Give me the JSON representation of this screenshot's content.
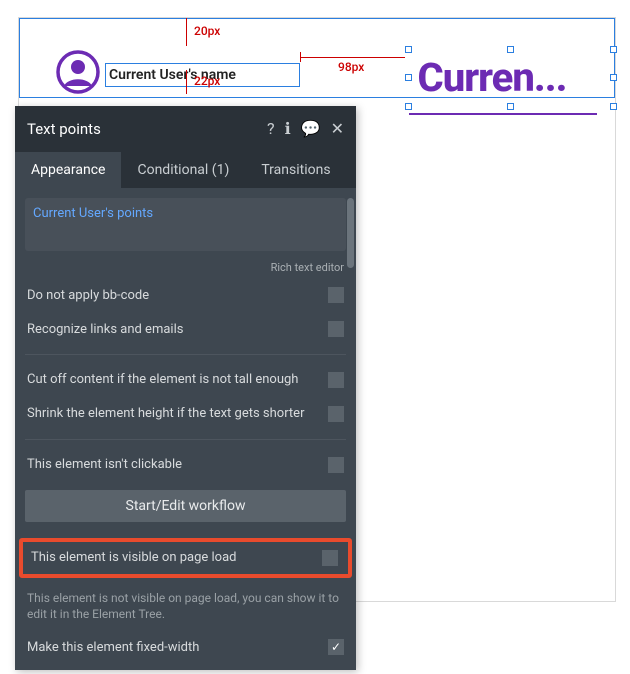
{
  "canvas": {
    "name_expression": "Current User's name",
    "big_text_display": "Curren...",
    "measurements": {
      "top_label": "20px",
      "bottom_label": "22px",
      "gap_label": "98px"
    }
  },
  "panel": {
    "title": "Text points",
    "icons": {
      "help": "help-icon",
      "info": "info-icon",
      "comment": "comment-icon",
      "close": "close-icon"
    },
    "tabs": [
      {
        "label": "Appearance",
        "active": true
      },
      {
        "label": "Conditional (1)",
        "active": false
      },
      {
        "label": "Transitions",
        "active": false
      }
    ],
    "text_value": "Current User's points",
    "rte_hint": "Rich text editor",
    "checks": {
      "no_bbcode": {
        "label": "Do not apply bb-code",
        "checked": false
      },
      "recognize_links": {
        "label": "Recognize links and emails",
        "checked": false
      },
      "cut_off": {
        "label": "Cut off content if the element is not tall enough",
        "checked": false
      },
      "shrink": {
        "label": "Shrink the element height if the text gets shorter",
        "checked": false
      },
      "not_clickable": {
        "label": "This element isn't clickable",
        "checked": false
      },
      "visible_on_load": {
        "label": "This element is visible on page load",
        "checked": false
      },
      "fixed_width": {
        "label": "Make this element fixed-width",
        "checked": true
      }
    },
    "workflow_btn": "Start/Edit workflow",
    "visibility_hint": "This element is not visible on page load, you can show it to edit it in the Element Tree."
  }
}
